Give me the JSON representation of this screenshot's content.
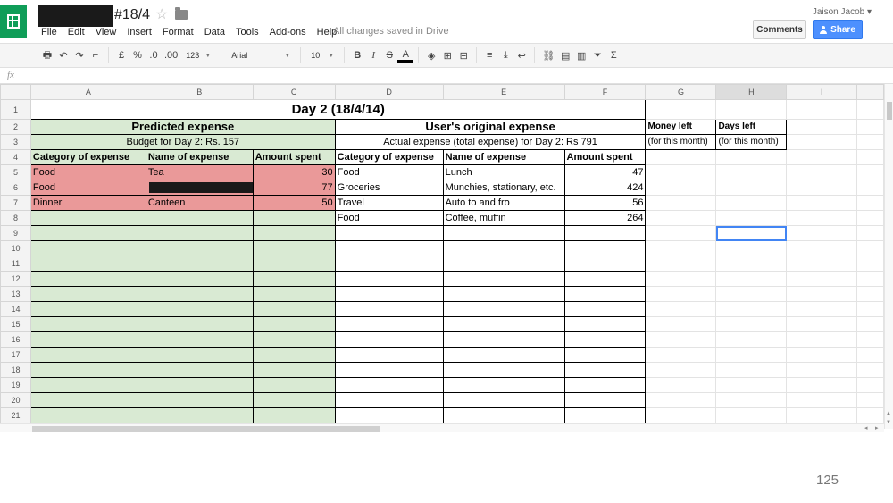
{
  "doc": {
    "title": "#18/4"
  },
  "menu": [
    "File",
    "Edit",
    "View",
    "Insert",
    "Format",
    "Data",
    "Tools",
    "Add-ons",
    "Help"
  ],
  "status": {
    "saved": "All changes saved in Drive"
  },
  "user": {
    "name": "Jaison Jacob ▾"
  },
  "buttons": {
    "comments": "Comments",
    "share": "Share"
  },
  "toolbar": {
    "currency": "£",
    "percent": "%",
    "dec_less": ".0←",
    "dec_more": ".00",
    "format": "123",
    "font": "Arial",
    "size": "10",
    "bold": "B",
    "italic": "I",
    "strike": "S",
    "textcolor": "A"
  },
  "formula": {
    "fx": "fx"
  },
  "columns": [
    "A",
    "B",
    "C",
    "D",
    "E",
    "F",
    "G",
    "H",
    "I"
  ],
  "rows": [
    "1",
    "2",
    "3",
    "4",
    "5",
    "6",
    "7",
    "8",
    "9",
    "10",
    "11",
    "12",
    "13",
    "14",
    "15",
    "16",
    "17",
    "18",
    "19",
    "20",
    "21"
  ],
  "sheet": {
    "day_title": "Day 2 (18/4/14)",
    "predicted_header": "Predicted expense",
    "predicted_budget": "Budget for Day 2: Rs. 157",
    "original_header": "User's original expense",
    "original_actual": "Actual expense (total expense) for Day 2: Rs 791",
    "money_left": "Money left",
    "days_left": "Days left",
    "for_month_g": "(for this month)",
    "for_month_h": "(for this month)",
    "hdr": {
      "cat_a": "Category of expense",
      "name_b": "Name of expense",
      "amt_c": "Amount spent",
      "cat_d": "Category of expense",
      "name_e": "Name of expense",
      "amt_f": "Amount spent"
    },
    "predicted": [
      {
        "cat": "Food",
        "name": "Tea",
        "amt": "30"
      },
      {
        "cat": "Food",
        "name": "",
        "amt": "77"
      },
      {
        "cat": "Dinner",
        "name": "Canteen",
        "amt": "50"
      }
    ],
    "original": [
      {
        "cat": "Food",
        "name": "Lunch",
        "amt": "47"
      },
      {
        "cat": "Groceries",
        "name": "Munchies, stationary, etc.",
        "amt": "424"
      },
      {
        "cat": "Travel",
        "name": "Auto to and fro",
        "amt": "56"
      },
      {
        "cat": "Food",
        "name": "Coffee, muffin",
        "amt": "264"
      }
    ]
  },
  "page_number": "125"
}
